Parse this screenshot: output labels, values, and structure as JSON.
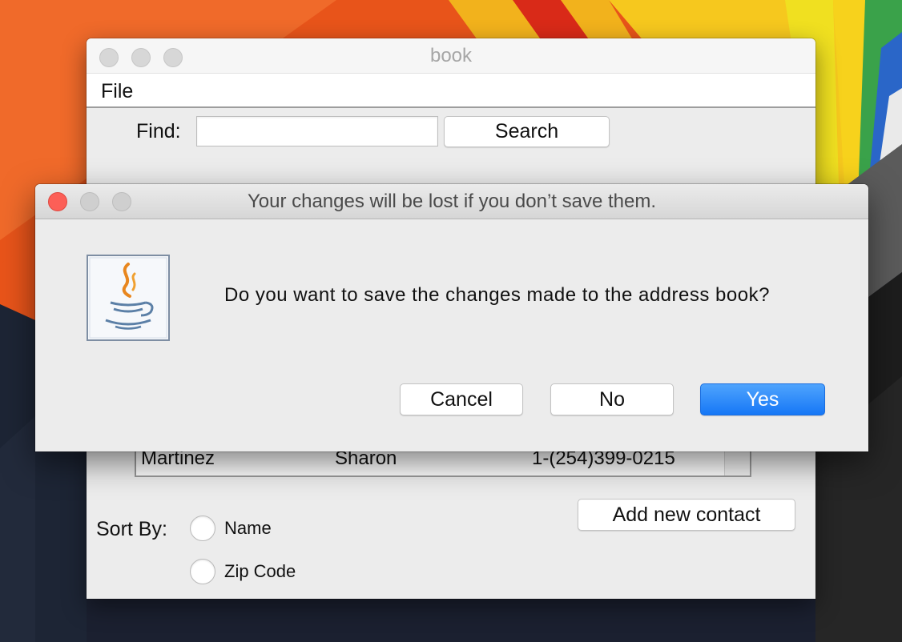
{
  "main_window": {
    "title": "book",
    "menu": {
      "file_label": "File"
    },
    "find": {
      "label": "Find:",
      "value": "",
      "search_label": "Search"
    },
    "contacts": {
      "rows": [
        {
          "last": "Martinez",
          "first": "Sharon",
          "phone": "1-(254)399-0215"
        }
      ]
    },
    "sort": {
      "label": "Sort By:",
      "options": [
        {
          "label": "Name",
          "selected": false
        },
        {
          "label": "Zip Code",
          "selected": false
        }
      ]
    },
    "add_contact_label": "Add new contact"
  },
  "dialog": {
    "title": "Your changes will be lost if you don’t save them.",
    "message": "Do you want to save the changes made to the address book?",
    "icon": "java-coffee-cup-icon",
    "buttons": {
      "cancel": "Cancel",
      "no": "No",
      "yes": "Yes"
    }
  },
  "colors": {
    "default_button": "#1677f6",
    "close_button": "#fc5f57",
    "wallpaper_orange": "#e8541a"
  }
}
